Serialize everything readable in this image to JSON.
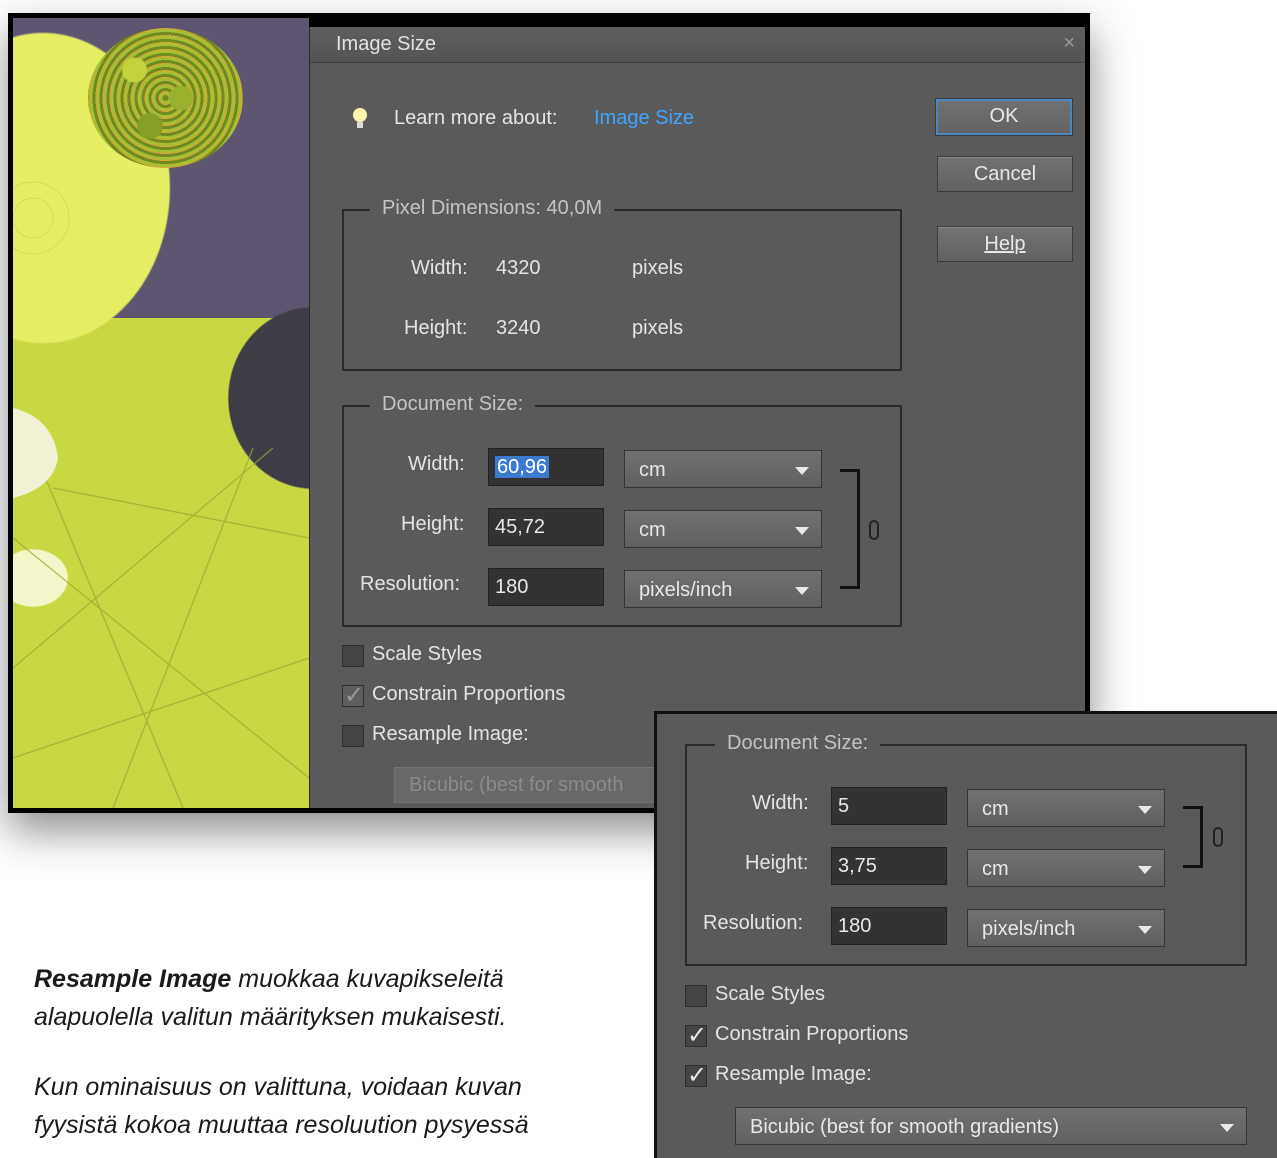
{
  "dialog": {
    "title": "Image Size",
    "close_glyph": "×",
    "learn_prefix": "Learn more about:",
    "learn_link": "Image Size",
    "buttons": {
      "ok": "OK",
      "cancel": "Cancel",
      "help": "Help"
    },
    "pixel_dimensions": {
      "legend": "Pixel Dimensions:",
      "size": "40,0M",
      "width_label": "Width:",
      "width_value": "4320",
      "width_unit": "pixels",
      "height_label": "Height:",
      "height_value": "3240",
      "height_unit": "pixels"
    },
    "document_size": {
      "legend": "Document Size:",
      "width_label": "Width:",
      "width_value": "60,96",
      "width_unit": "cm",
      "height_label": "Height:",
      "height_value": "45,72",
      "height_unit": "cm",
      "resolution_label": "Resolution:",
      "resolution_value": "180",
      "resolution_unit": "pixels/inch"
    },
    "options": {
      "scale_styles": {
        "label": "Scale Styles",
        "checked": false
      },
      "constrain": {
        "label": "Constrain Proportions",
        "checked": true
      },
      "resample": {
        "label": "Resample Image:",
        "checked": false
      }
    },
    "resample_method": "Bicubic (best for smooth"
  },
  "zoom": {
    "document_size": {
      "legend": "Document Size:",
      "width_label": "Width:",
      "width_value": "5",
      "width_unit": "cm",
      "height_label": "Height:",
      "height_value": "3,75",
      "height_unit": "cm",
      "resolution_label": "Resolution:",
      "resolution_value": "180",
      "resolution_unit": "pixels/inch"
    },
    "options": {
      "scale_styles": {
        "label": "Scale Styles",
        "checked": false
      },
      "constrain": {
        "label": "Constrain Proportions",
        "checked": true
      },
      "resample": {
        "label": "Resample Image:",
        "checked": true
      }
    },
    "resample_method": "Bicubic (best for smooth gradients)"
  },
  "caption": {
    "p1_bold": "Resample Image",
    "p1_rest": " muokkaa kuvapikseleitä",
    "p1_line2": "alapuolella valitun määrityksen mukaisesti.",
    "p2_line1": "Kun ominaisuus on valittuna, voidaan kuvan",
    "p2_line2": "fyysistä kokoa muuttaa resoluution pysyessä"
  },
  "colors": {
    "dialog_bg": "#5a5a5a",
    "link": "#3fa4ff",
    "selection": "#3c7ad0"
  }
}
